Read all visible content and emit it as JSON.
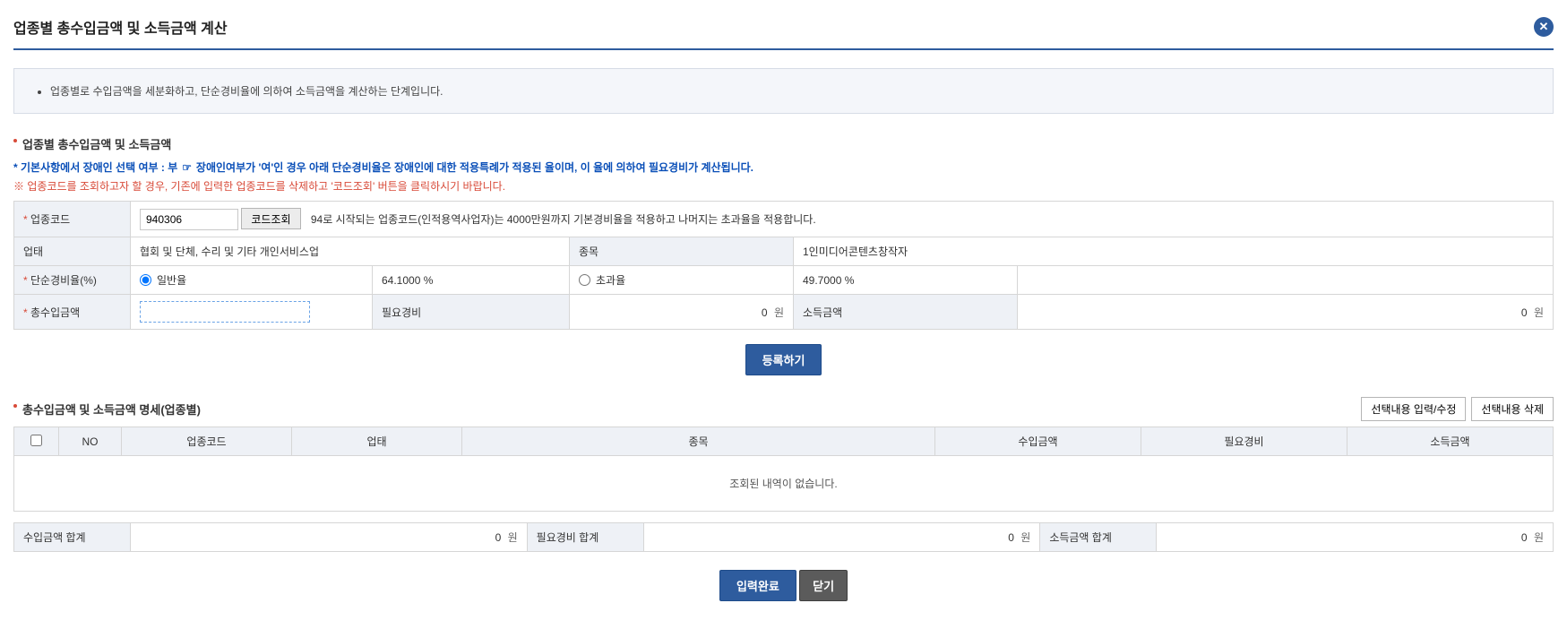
{
  "header": {
    "title": "업종별 총수입금액 및 소득금액 계산"
  },
  "info": {
    "text": "업종별로 수입금액을 세분화하고, 단순경비율에 의하여 소득금액을 계산하는 단계입니다."
  },
  "section1": {
    "title": "업종별 총수입금액 및 소득금액",
    "note1_prefix": "* 기본사항에서 장애인 선택 여부 : 부",
    "note1_pointer": "☞",
    "note1_text": "장애인여부가 '여'인 경우 아래 단순경비율은 장애인에 대한 적용특례가 적용된 율이며, 이 율에 의하여 필요경비가 계산됩니다.",
    "note2_prefix": "※",
    "note2_text": "업종코드를 조회하고자 할 경우, 기존에 입력한 업종코드를 삭제하고 '코드조회' 버튼을 클릭하시기 바랍니다."
  },
  "form": {
    "code_label": "업종코드",
    "code_value": "940306",
    "code_btn": "코드조회",
    "code_desc": "94로 시작되는 업종코드(인적용역사업자)는 4000만원까지 기본경비율을 적용하고 나머지는 초과율을 적용합니다.",
    "uptae_label": "업태",
    "uptae_value": "협회 및 단체, 수리 및 기타 개인서비스업",
    "jongmok_label": "종목",
    "jongmok_value": "1인미디어콘텐츠창작자",
    "rate_label": "단순경비율(%)",
    "rate_general_label": "일반율",
    "rate_general_value": "64.1000 %",
    "rate_over_label": "초과율",
    "rate_over_value": "49.7000 %",
    "income_label": "총수입금액",
    "income_value": "",
    "expense_label": "필요경비",
    "expense_value": "0",
    "profit_label": "소득금액",
    "profit_value": "0",
    "unit": "원",
    "register_btn": "등록하기"
  },
  "section2": {
    "title": "총수입금액 및 소득금액 명세(업종별)",
    "btn_edit": "선택내용 입력/수정",
    "btn_delete": "선택내용 삭제"
  },
  "grid": {
    "cols": [
      "NO",
      "업종코드",
      "업태",
      "종목",
      "수입금액",
      "필요경비",
      "소득금액"
    ],
    "empty": "조회된 내역이 없습니다."
  },
  "totals": {
    "income_label": "수입금액 합계",
    "income_value": "0",
    "expense_label": "필요경비 합계",
    "expense_value": "0",
    "profit_label": "소득금액 합계",
    "profit_value": "0",
    "unit": "원"
  },
  "footer": {
    "complete": "입력완료",
    "close": "닫기"
  }
}
